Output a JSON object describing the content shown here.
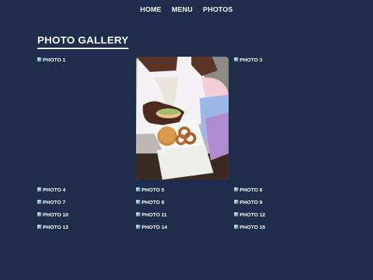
{
  "nav": {
    "home": "HOME",
    "menu": "MENU",
    "photos": "PHOTOS"
  },
  "page_title": "PHOTO GALLERY",
  "photos": [
    "PHOTO 1",
    "PHOTO 3",
    "PHOTO 4",
    "PHOTO 5",
    "PHOTO 6",
    "PHOTO 7",
    "PHOTO 8",
    "PHOTO 9",
    "PHOTO 10",
    "PHOTO 11",
    "PHOTO 12",
    "PHOTO 13",
    "PHOTO 14",
    "PHOTO 15"
  ],
  "featured_photo": {
    "icon": "burger-photo"
  },
  "colors": {
    "background": "#1d2d4b",
    "text": "#ffffff"
  }
}
